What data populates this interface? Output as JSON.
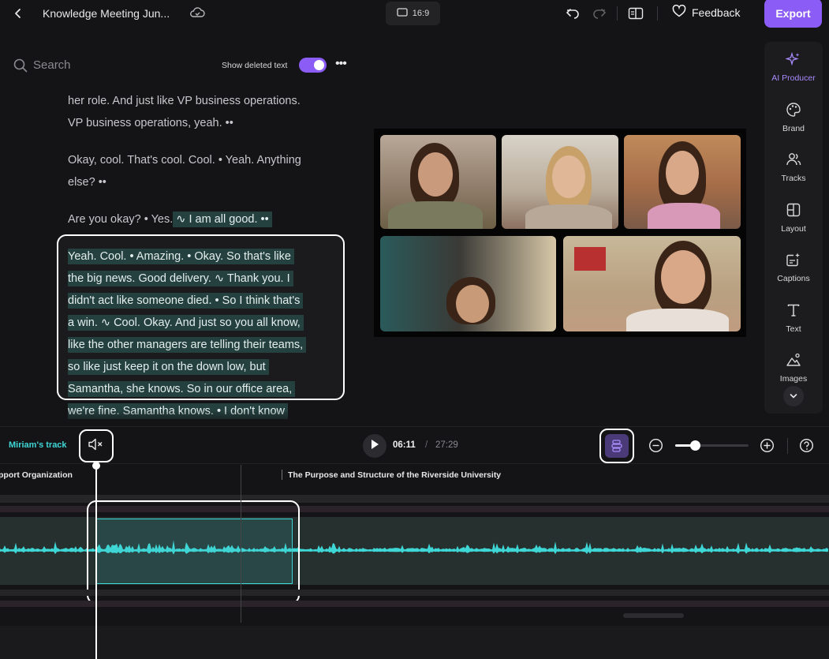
{
  "topbar": {
    "title": "Knowledge Meeting Jun...",
    "aspect_ratio": "16:9",
    "feedback_label": "Feedback",
    "export_label": "Export"
  },
  "search": {
    "placeholder": "Search",
    "show_deleted_label": "Show deleted text",
    "show_deleted_on": true
  },
  "transcript": {
    "para1": [
      "her role. And just like VP business operations.",
      "VP business operations, yeah. ••"
    ],
    "para2": [
      "Okay, cool. That's cool. Cool. • Yeah. Anything",
      "else? ••"
    ],
    "para3_plain": "Are you okay? • Yes.",
    "para3_hl": "∿ I am all good. ••",
    "para4": [
      "Yeah. Cool. • Amazing. • Okay. So that's like",
      "the big news. Good delivery. ∿ Thank you. I",
      "didn't act like someone died. • So I think that's",
      "a win. ∿ Cool. Okay. And just so you all know,",
      "like the other managers are telling their teams,",
      "so like just keep it on the down low, but",
      "Samantha, she knows. So in our office area,",
      "we're fine. Samantha knows. • I don't know"
    ]
  },
  "sidebar": {
    "items": [
      {
        "label": "AI Producer",
        "icon": "sparkle-icon",
        "active": true
      },
      {
        "label": "Brand",
        "icon": "palette-icon"
      },
      {
        "label": "Tracks",
        "icon": "users-icon"
      },
      {
        "label": "Layout",
        "icon": "layout-icon"
      },
      {
        "label": "Captions",
        "icon": "captions-icon"
      },
      {
        "label": "Text",
        "icon": "text-icon"
      },
      {
        "label": "Images",
        "icon": "image-icon"
      }
    ]
  },
  "player": {
    "track_name": "Miriam's track",
    "current_time": "06:11",
    "separator": "/",
    "total_time": "27:29",
    "zoom_level": 0.27
  },
  "timeline": {
    "chapters": [
      "pport Organization",
      "The Purpose and Structure of the Riverside University"
    ]
  },
  "colors": {
    "accent": "#8b5cf6",
    "teal": "#3fd6d6",
    "background": "#141416"
  }
}
